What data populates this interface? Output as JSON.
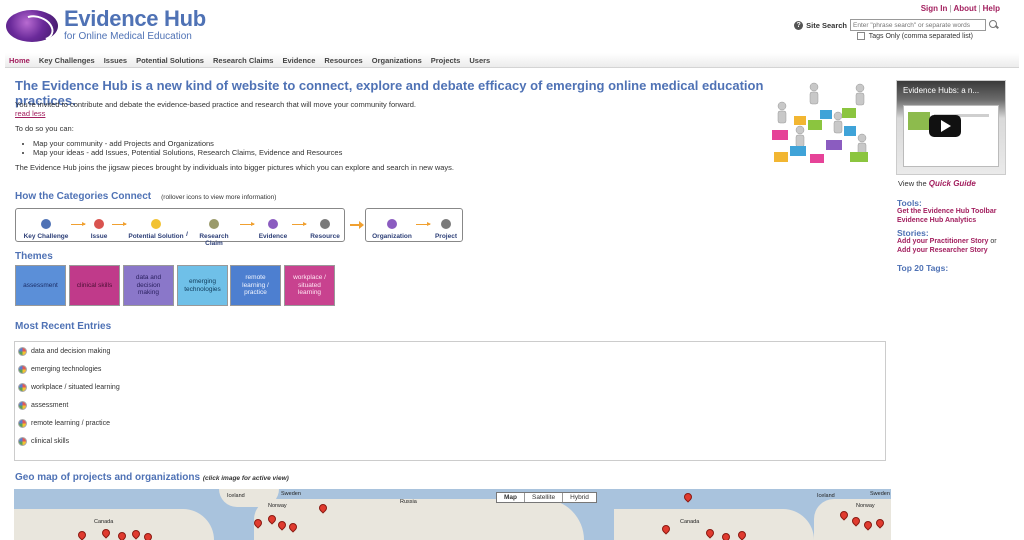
{
  "header": {
    "logo_title": "Evidence Hub",
    "logo_subtitle": "for Online Medical Education",
    "links": [
      "Sign In",
      "About",
      "Help"
    ],
    "search_label": "Site Search",
    "search_placeholder": "Enter \"phrase search\" or separate words",
    "tags_only_label": "Tags Only (comma separated list)"
  },
  "nav": [
    "Home",
    "Key Challenges",
    "Issues",
    "Potential Solutions",
    "Research Claims",
    "Evidence",
    "Resources",
    "Organizations",
    "Projects",
    "Users"
  ],
  "intro": {
    "headline": "The Evidence Hub is a new kind of website to connect, explore and debate efficacy of emerging online medical education practices.",
    "p1": "You're invited to contribute and debate the evidence-based practice and research that will move your community forward.",
    "read_less": "read less",
    "p2": "To do so you can:",
    "bullets": [
      "Map your community - add Projects and Organizations",
      "Map your ideas - add Issues, Potential Solutions, Research Claims, Evidence and Resources"
    ],
    "p3": "The Evidence Hub joins the jigsaw pieces brought by individuals into bigger pictures which you can explore and search in new ways."
  },
  "categories": {
    "title": "How the Categories Connect",
    "note": "(rollover icons to view more information)",
    "items": [
      "Key Challenge",
      "Issue",
      "Potential Solution",
      "/",
      "Research Claim",
      "Evidence",
      "Resource",
      "Organization",
      "Project"
    ]
  },
  "themes": {
    "title": "Themes",
    "items": [
      {
        "label": "assessment",
        "bg": "#5b8fd8",
        "fg": "#1b2d66"
      },
      {
        "label": "clinical skills",
        "bg": "#c03a8a",
        "fg": "#4a0f34"
      },
      {
        "label": "data and decision making",
        "bg": "#8a77c9",
        "fg": "#2b2160"
      },
      {
        "label": "emerging technologies",
        "bg": "#6fc0e8",
        "fg": "#0f3a5a"
      },
      {
        "label": "remote learning / practice",
        "bg": "#4d7fd0",
        "fg": "#f2f5ff"
      },
      {
        "label": "workplace / situated learning",
        "bg": "#c8428f",
        "fg": "#ffe6f3"
      }
    ]
  },
  "recent": {
    "title": "Most Recent Entries",
    "items": [
      "data and decision making",
      "emerging technologies",
      "workplace / situated learning",
      "assessment",
      "remote learning / practice",
      "clinical skills"
    ]
  },
  "map": {
    "title": "Geo map of projects and organizations",
    "note": "(click image for active view)",
    "buttons": [
      "Map",
      "Satellite",
      "Hybrid"
    ],
    "labels": [
      "Iceland",
      "Sweden",
      "Norway",
      "Russia",
      "Canada",
      "Iceland",
      "Sweden",
      "Norway",
      "Canada"
    ]
  },
  "sidebar": {
    "video_title": "Evidence Hubs: a n...",
    "view_the": "View the",
    "quick_guide": "Quick Guide",
    "tools_title": "Tools:",
    "tools": [
      "Get the Evidence Hub Toolbar",
      "Evidence Hub Analytics"
    ],
    "stories_title": "Stories:",
    "story1": "Add your Practitioner Story",
    "story_or": "or",
    "story2": "Add your Researcher Story",
    "tags_title": "Top 20 Tags:"
  },
  "colors": {
    "accent_blue": "#4f72b5",
    "accent_magenta": "#a3205f",
    "arrow_orange": "#f0a030"
  }
}
